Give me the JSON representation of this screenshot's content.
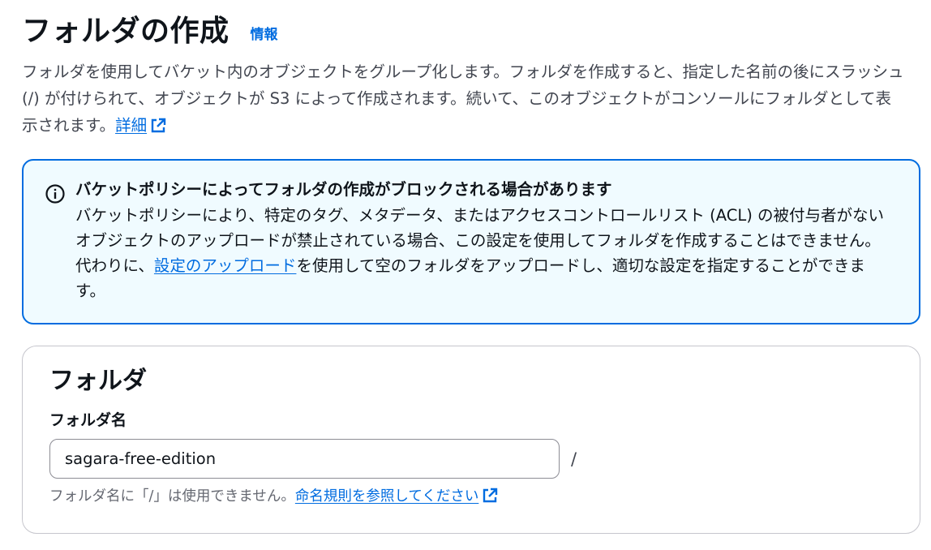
{
  "header": {
    "title": "フォルダの作成",
    "info_link": "情報"
  },
  "description": {
    "text": "フォルダを使用してバケット内のオブジェクトをグループ化します。フォルダを作成すると、指定した名前の後にスラッシュ (/) が付けられて、オブジェクトが S3 によって作成されます。続いて、このオブジェクトがコンソールにフォルダとして表示されます。",
    "learn_more": "詳細"
  },
  "alert": {
    "title": "バケットポリシーによってフォルダの作成がブロックされる場合があります",
    "body_before": "バケットポリシーにより、特定のタグ、メタデータ、またはアクセスコントロールリスト (ACL) の被付与者がないオブジェクトのアップロードが禁止されている場合、この設定を使用してフォルダを作成することはできません。代わりに、",
    "body_link": "設定のアップロード",
    "body_after": "を使用して空のフォルダをアップロードし、適切な設定を指定することができます。"
  },
  "folder_section": {
    "title": "フォルダ",
    "field_label": "フォルダ名",
    "input_value": "sagara-free-edition",
    "suffix": "/",
    "constraint_text": "フォルダ名に「/」は使用できません。",
    "constraint_link": "命名規則を参照してください"
  },
  "colors": {
    "link": "#006ce0",
    "alert_border": "#006ce0",
    "alert_background": "#f0fbff"
  },
  "icons": {
    "info": "info-circle-icon",
    "external": "external-link-icon"
  }
}
